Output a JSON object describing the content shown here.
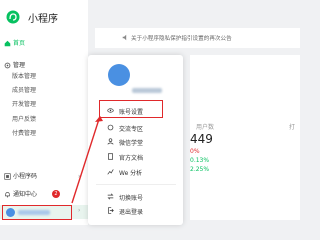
{
  "app": {
    "title": "小程序",
    "brand_color": "#07c160",
    "alert_color": "#e0292b",
    "logo_icon": "mini-program-logo-icon"
  },
  "sidebar": {
    "home_label": "首页",
    "manage_label": "管理",
    "manage_items": [
      "版本管理",
      "成员管理",
      "开发管理",
      "用户反馈",
      "付费管理"
    ],
    "mini_code_label": "小程序码",
    "notification_label": "通知中心",
    "notification_count": "2"
  },
  "main": {
    "notice_text": "关于小程序隐私保护指引设置的再次公告",
    "stat_number": "449",
    "stat_zero": "0%",
    "stat_up1": "0.13%",
    "stat_up2": "2.25%",
    "right_cut_top": "用户数",
    "right_cut_label": "打"
  },
  "popup": {
    "items": [
      {
        "label": "账号设置",
        "icon": "eye-settings-icon"
      },
      {
        "label": "交流专区",
        "icon": "refresh-icon"
      },
      {
        "label": "微信学堂",
        "icon": "people-icon"
      },
      {
        "label": "官方文档",
        "icon": "document-icon"
      },
      {
        "label": "We 分析",
        "icon": "chart-icon"
      },
      {
        "label": "切换账号",
        "icon": "swap-icon"
      },
      {
        "label": "退出登录",
        "icon": "logout-icon"
      }
    ]
  }
}
